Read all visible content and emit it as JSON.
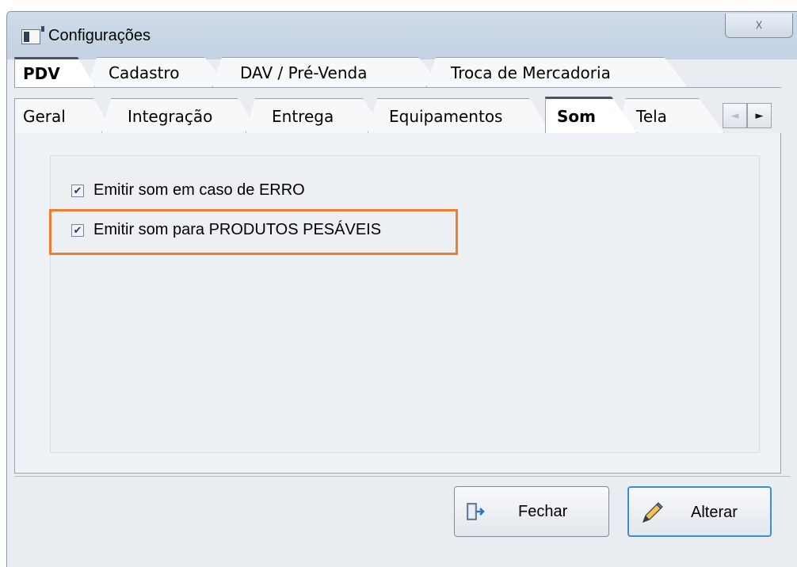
{
  "window": {
    "title": "Configurações",
    "close_symbol": "☓"
  },
  "tabs_top": [
    {
      "label": "PDV",
      "active": true
    },
    {
      "label": "Cadastro",
      "active": false
    },
    {
      "label": "DAV / Pré-Venda",
      "active": false
    },
    {
      "label": "Troca de Mercadoria",
      "active": false
    }
  ],
  "tabs_sub": [
    {
      "label": "Geral",
      "active": false
    },
    {
      "label": "Integração",
      "active": false
    },
    {
      "label": "Entrega",
      "active": false
    },
    {
      "label": "Equipamentos",
      "active": false
    },
    {
      "label": "Som",
      "active": true
    },
    {
      "label": "Tela",
      "active": false
    }
  ],
  "tab_scroll": {
    "left": "◄",
    "right": "►"
  },
  "options": [
    {
      "label": "Emitir som em caso de ERRO",
      "checked": true
    },
    {
      "label": "Emitir som para PRODUTOS PESÁVEIS",
      "checked": true,
      "highlighted": true
    }
  ],
  "check_mark": "✔",
  "buttons": {
    "close_label": "Fechar",
    "alter_label": "Alterar"
  },
  "colors": {
    "highlight": "#ed7d31",
    "primary_border": "#3c8fd6"
  }
}
